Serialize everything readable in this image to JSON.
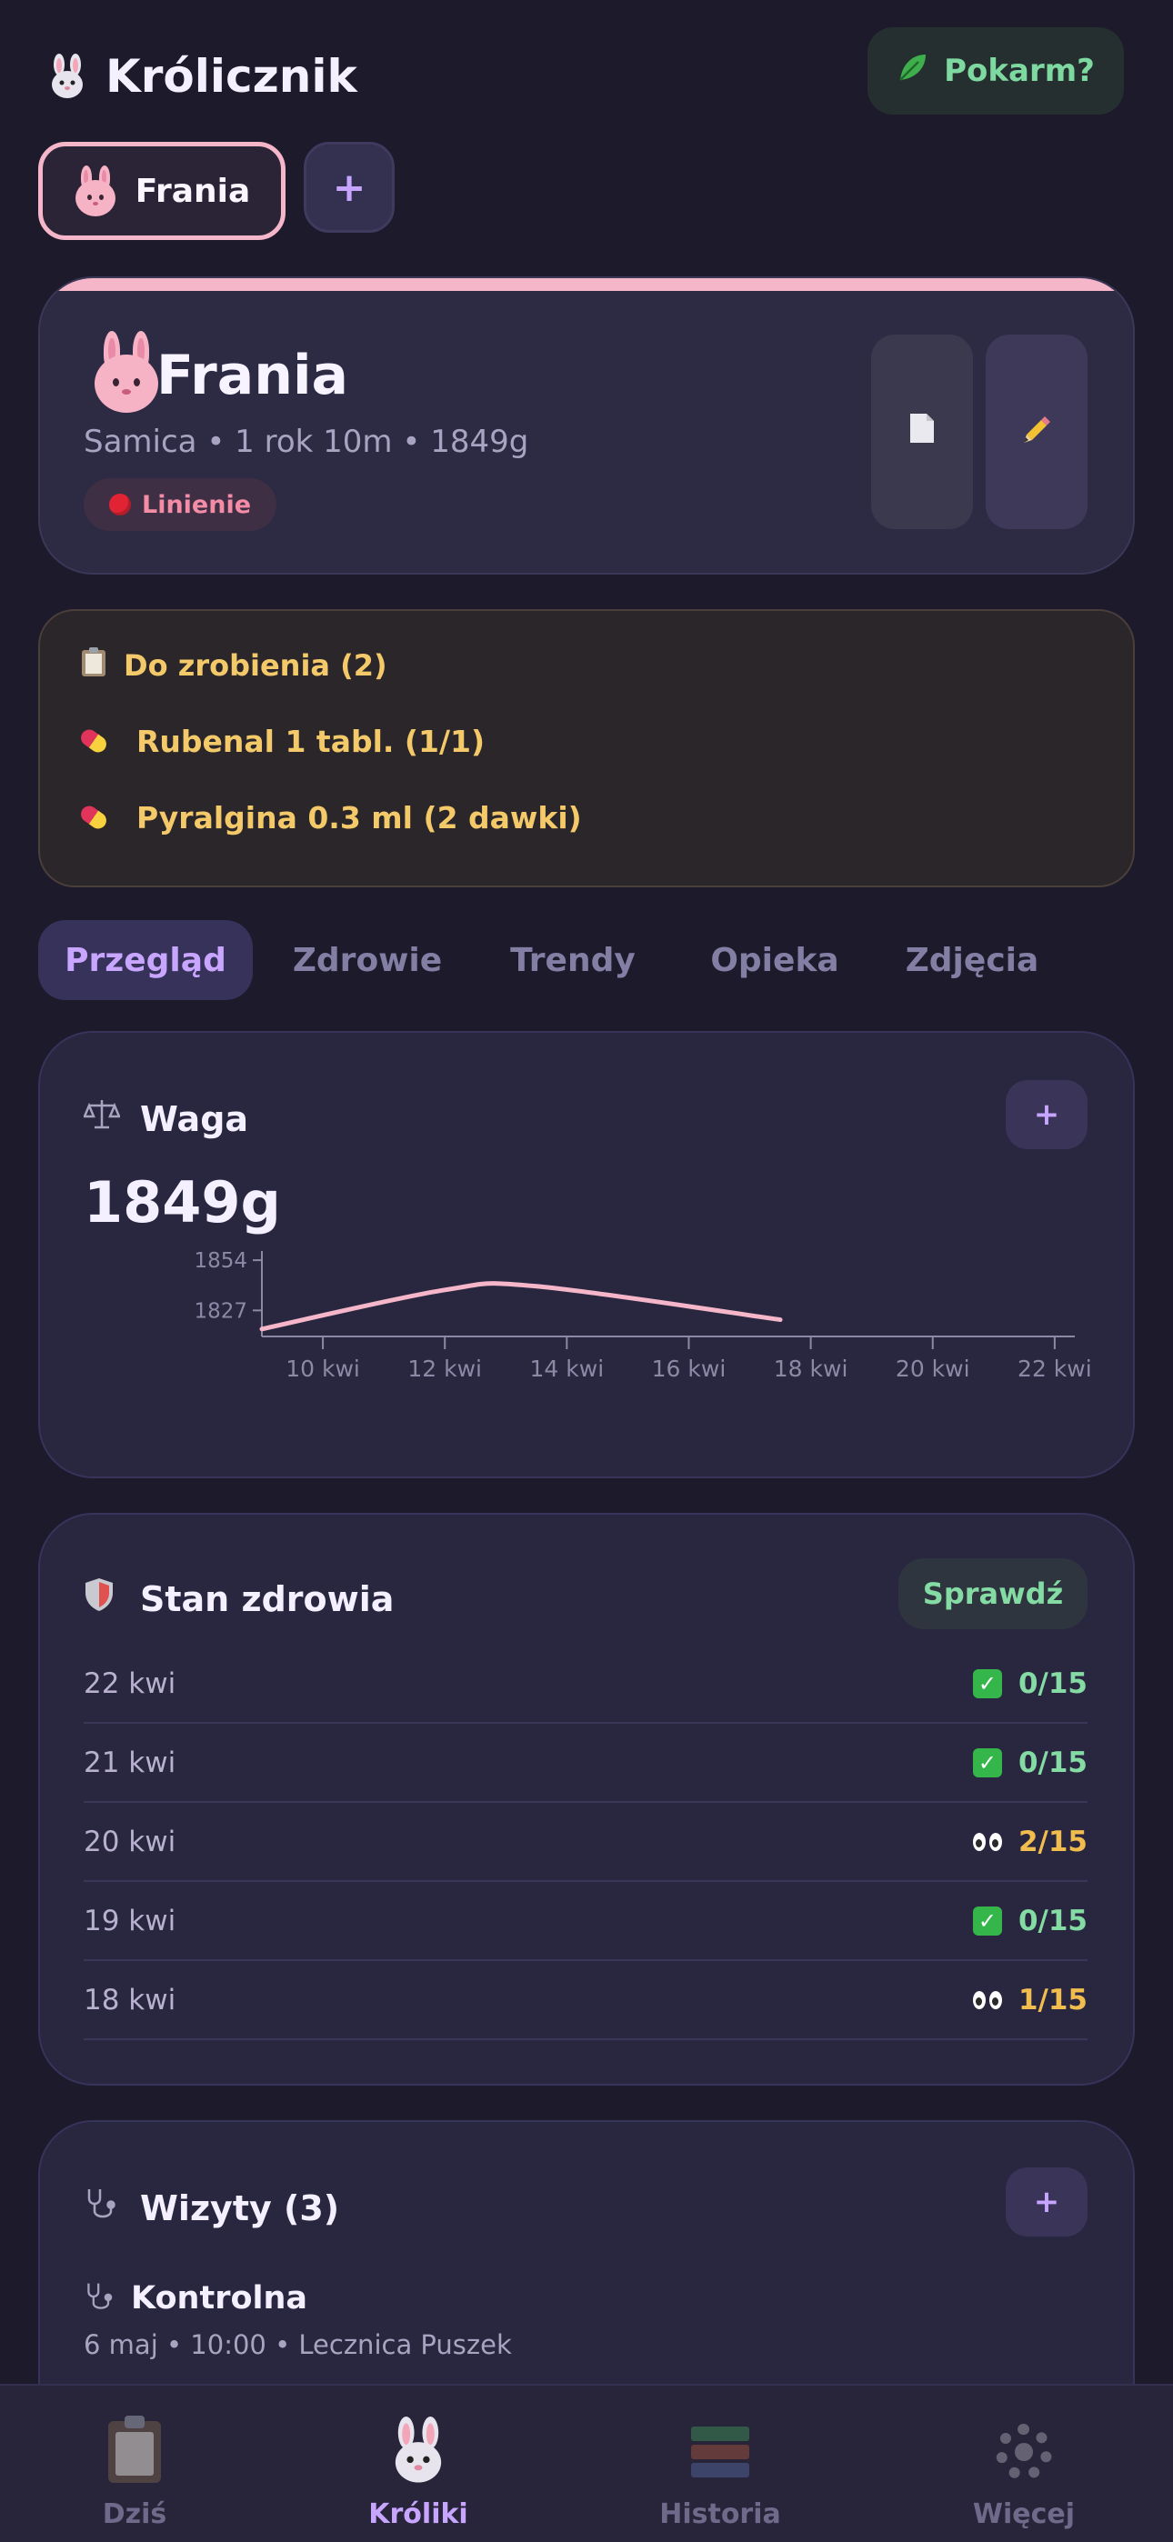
{
  "header": {
    "title": "Królicznik",
    "food_button": "Pokarm?"
  },
  "rabbit_tabs": {
    "selected": "Frania",
    "add_label": "+"
  },
  "profile": {
    "name": "Frania",
    "subtitle": "Samica • 1 rok 10m • 1849g",
    "status": "Linienie"
  },
  "todo": {
    "title": "Do zrobienia (2)",
    "items": [
      "Rubenal 1 tabl. (1/1)",
      "Pyralgina 0.3 ml (2 dawki)"
    ]
  },
  "tabs": [
    "Przegląd",
    "Zdrowie",
    "Trendy",
    "Opieka",
    "Zdjęcia"
  ],
  "weight": {
    "title": "Waga",
    "value": "1849g",
    "add_label": "+"
  },
  "chart_data": {
    "type": "line",
    "x_ticks": [
      "10 kwi",
      "12 kwi",
      "14 kwi",
      "16 kwi",
      "18 kwi",
      "20 kwi",
      "22 kwi"
    ],
    "y_ticks": [
      1854,
      1827
    ],
    "series": [
      {
        "values": [
          {
            "x": "9 kwi",
            "y": 1817
          },
          {
            "x": "12 kwi",
            "y": 1838
          },
          {
            "x": "13.5 kwi",
            "y": 1840
          },
          {
            "x": "17.5 kwi",
            "y": 1822
          }
        ]
      }
    ],
    "color": "#f4b6c8"
  },
  "health": {
    "title": "Stan zdrowia",
    "check_button": "Sprawdź",
    "rows": [
      {
        "date": "22 kwi",
        "score": "0/15",
        "status": "ok"
      },
      {
        "date": "21 kwi",
        "score": "0/15",
        "status": "ok"
      },
      {
        "date": "20 kwi",
        "score": "2/15",
        "status": "warn"
      },
      {
        "date": "19 kwi",
        "score": "0/15",
        "status": "ok"
      },
      {
        "date": "18 kwi",
        "score": "1/15",
        "status": "warn"
      }
    ]
  },
  "visits": {
    "title": "Wizyty (3)",
    "add_label": "+",
    "first": {
      "title": "Kontrolna",
      "details": "6 maj • 10:00 • Lecznica Puszek"
    }
  },
  "bottom_nav": [
    {
      "label": "Dziś",
      "icon": "clipboard-icon",
      "active": false
    },
    {
      "label": "Króliki",
      "icon": "rabbit-icon",
      "active": true
    },
    {
      "label": "Historia",
      "icon": "books-icon",
      "active": false
    },
    {
      "label": "Więcej",
      "icon": "gear-icon",
      "active": false
    }
  ],
  "colors": {
    "accent_pink": "#f4b6c8",
    "accent_purple": "#c8a6ff",
    "green": "#84dba3",
    "amber": "#f2bd4f",
    "background": "#1c1a2b"
  }
}
